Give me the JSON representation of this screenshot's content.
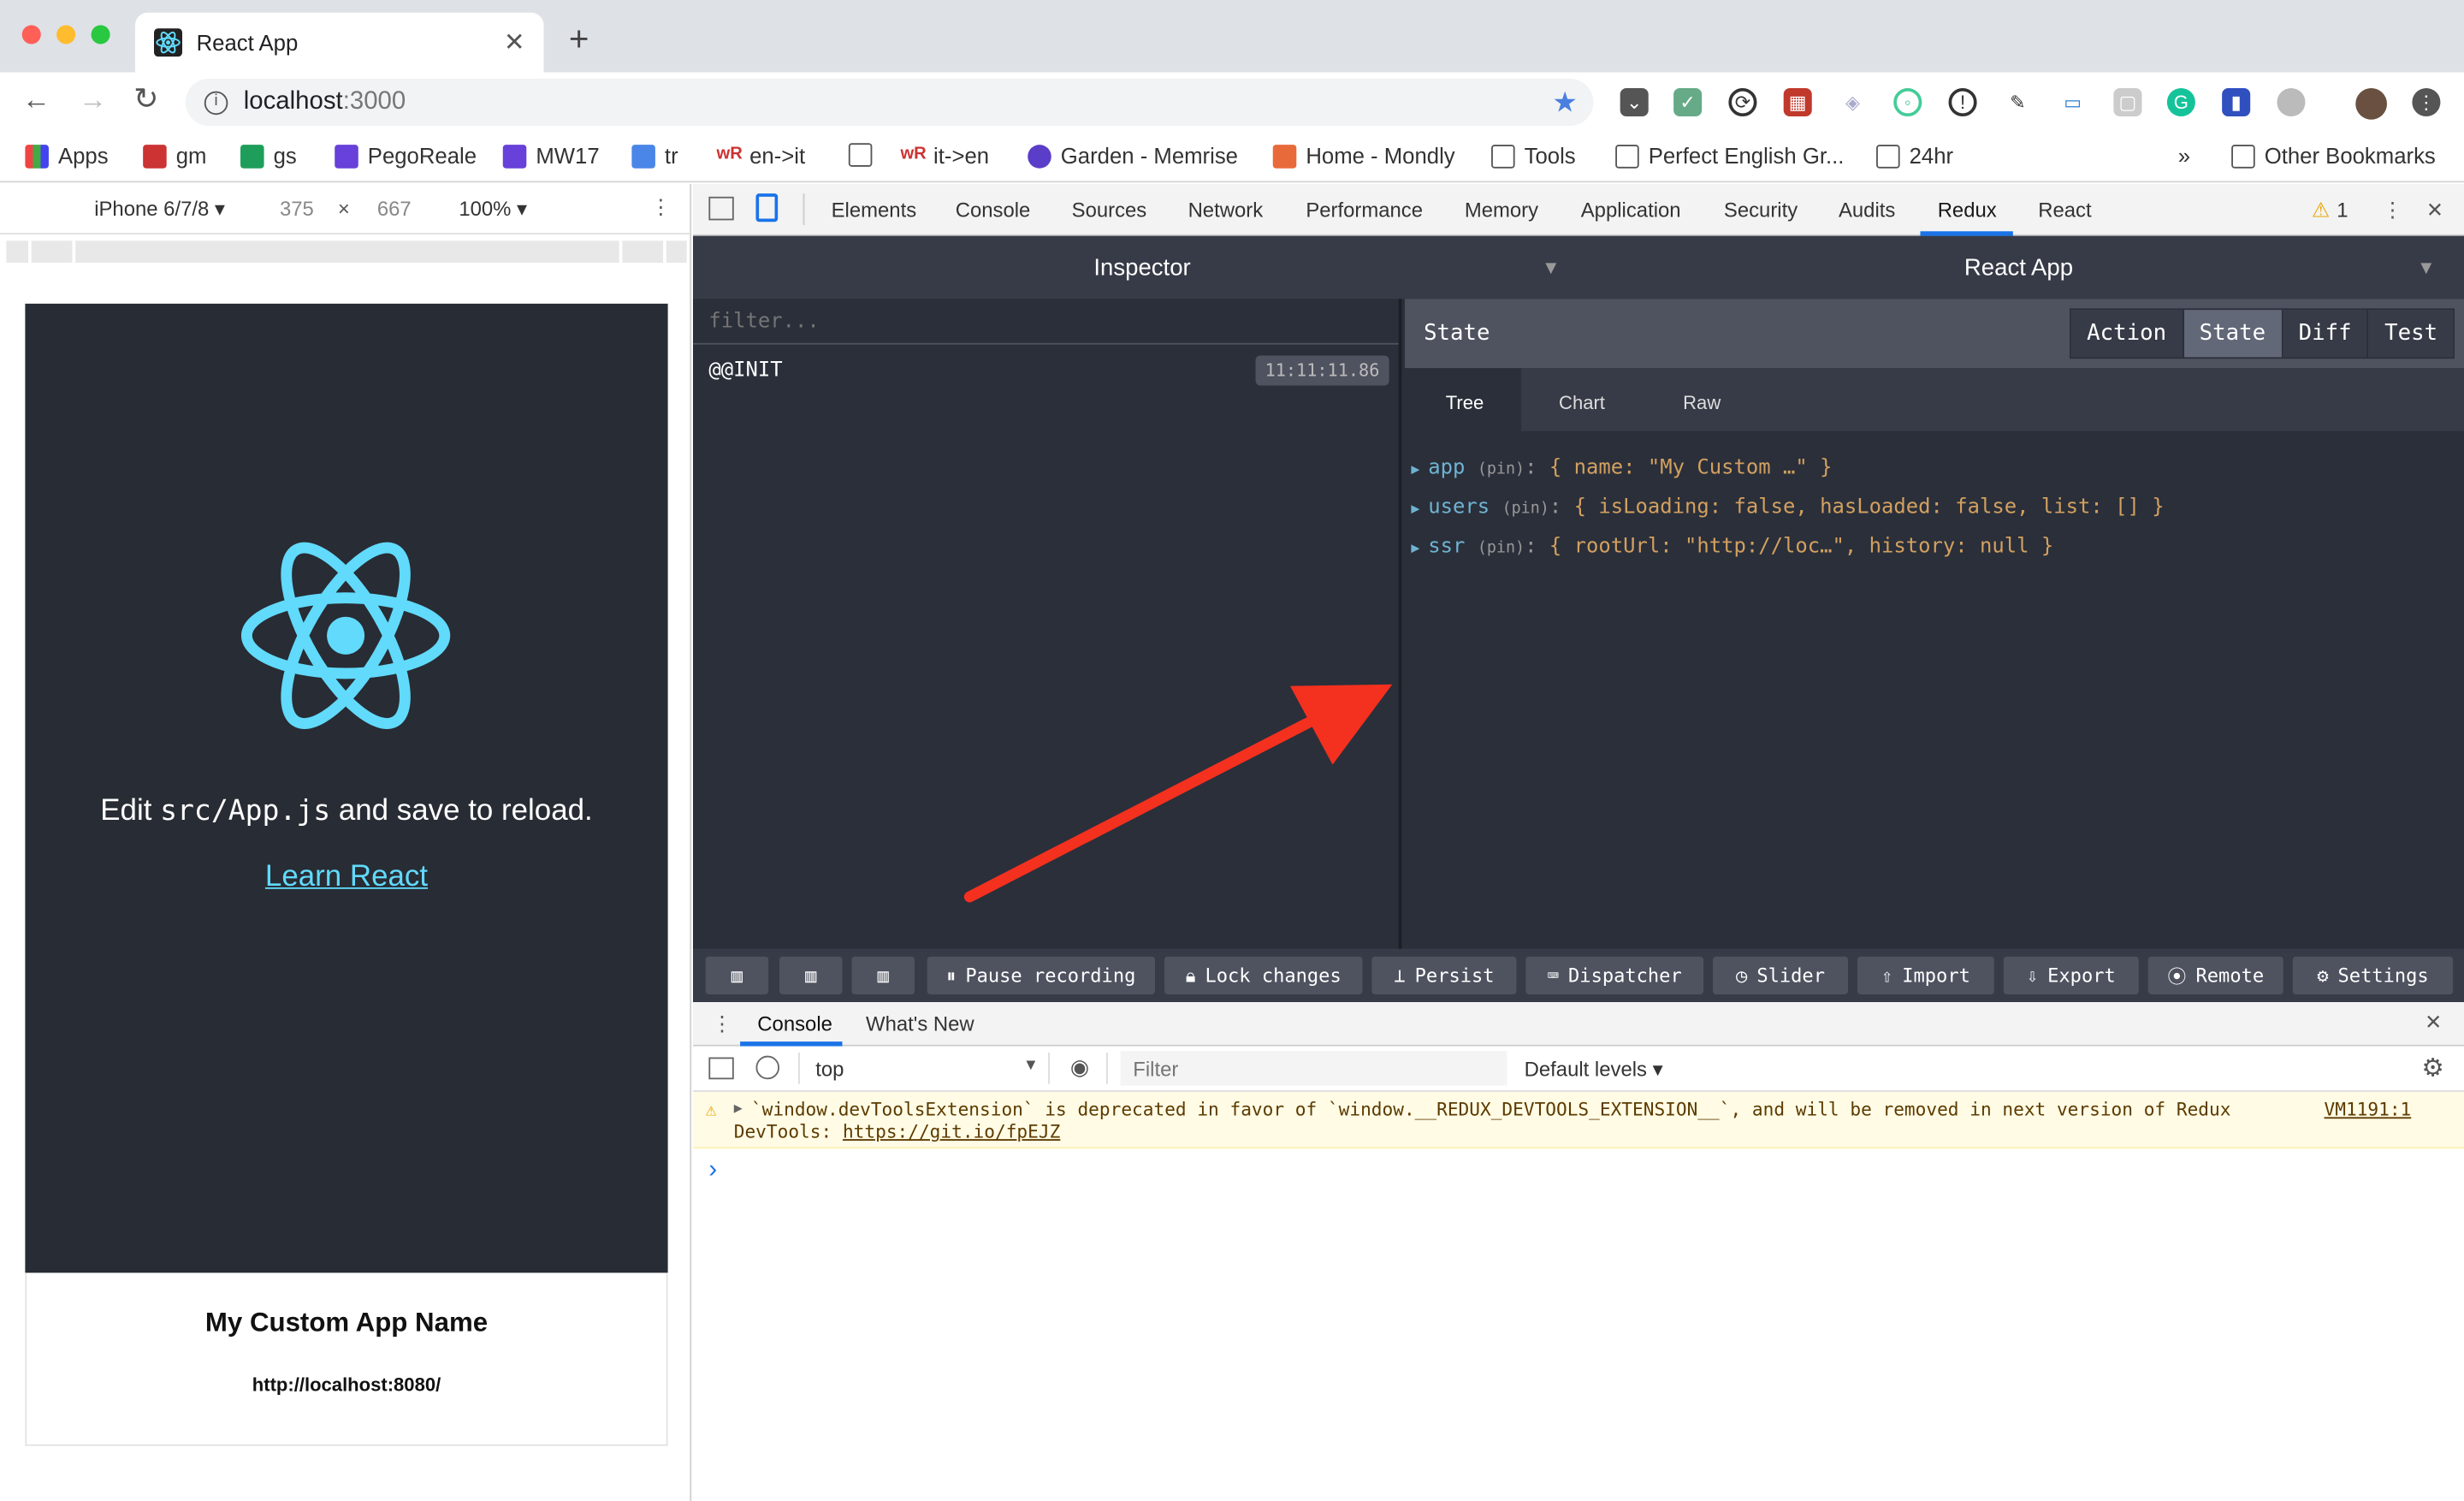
{
  "browser": {
    "tab_title": "React App",
    "url_host": "localhost",
    "url_port": ":3000",
    "bookmarks": [
      "Apps",
      "gm",
      "gs",
      "PegoReale",
      "MW17",
      "tr",
      "en->it",
      "it->en",
      "Garden - Memrise",
      "Home - Mondly",
      "Tools",
      "Perfect English Gr...",
      "24hr"
    ],
    "more_bookmarks": "»",
    "other_bookmarks": "Other Bookmarks"
  },
  "device": {
    "model": "iPhone 6/7/8 ▾",
    "width": "375",
    "times": "×",
    "height": "667",
    "zoom": "100% ▾"
  },
  "app": {
    "edit_prefix": "Edit ",
    "edit_code": "src/App.js",
    "edit_suffix": " and save to reload.",
    "learn_link": "Learn React",
    "app_name": "My Custom App Name",
    "root_url": "http://localhost:8080/"
  },
  "devtools": {
    "tabs": [
      "Elements",
      "Console",
      "Sources",
      "Network",
      "Performance",
      "Memory",
      "Application",
      "Security",
      "Audits",
      "Redux",
      "React"
    ],
    "active_tab": "Redux",
    "warning_count": "1"
  },
  "redux": {
    "inspector_title": "Inspector",
    "instance_title": "React App",
    "filter_placeholder": "filter...",
    "action_name": "@@INIT",
    "action_time": "11:11:11.86",
    "state_label": "State",
    "mode_buttons": [
      "Action",
      "State",
      "Diff",
      "Test"
    ],
    "active_mode": "State",
    "view_tabs": [
      "Tree",
      "Chart",
      "Raw"
    ],
    "active_view": "Tree",
    "tree": [
      {
        "key": "app",
        "pin": "(pin)",
        "value": "{ name: \"My Custom …\" }"
      },
      {
        "key": "users",
        "pin": "(pin)",
        "value": "{ isLoading: false, hasLoaded: false, list: [] }"
      },
      {
        "key": "ssr",
        "pin": "(pin)",
        "value": "{ rootUrl: \"http://loc…\", history: null }"
      }
    ],
    "bottom_buttons": [
      "Pause recording",
      "Lock changes",
      "Persist",
      "Dispatcher",
      "Slider",
      "Import",
      "Export",
      "Remote",
      "Settings"
    ]
  },
  "console": {
    "tabs": [
      "Console",
      "What's New"
    ],
    "context": "top",
    "filter_placeholder": "Filter",
    "levels": "Default levels ▾",
    "warning_text": "`window.devToolsExtension` is deprecated in favor of `window.__REDUX_DEVTOOLS_EXTENSION__`, and will be removed in next version of Redux",
    "warning_text2": "DevTools: ",
    "warning_link": "https://git.io/fpEJZ",
    "warning_source": "VM1191:1",
    "prompt": "›"
  },
  "colors": {
    "arrow": "#f4301f",
    "react_blue": "#61dafb",
    "redux_bg": "#2a2f3a",
    "tree_key": "#6fb3d2",
    "tree_value": "#d3a05f"
  }
}
